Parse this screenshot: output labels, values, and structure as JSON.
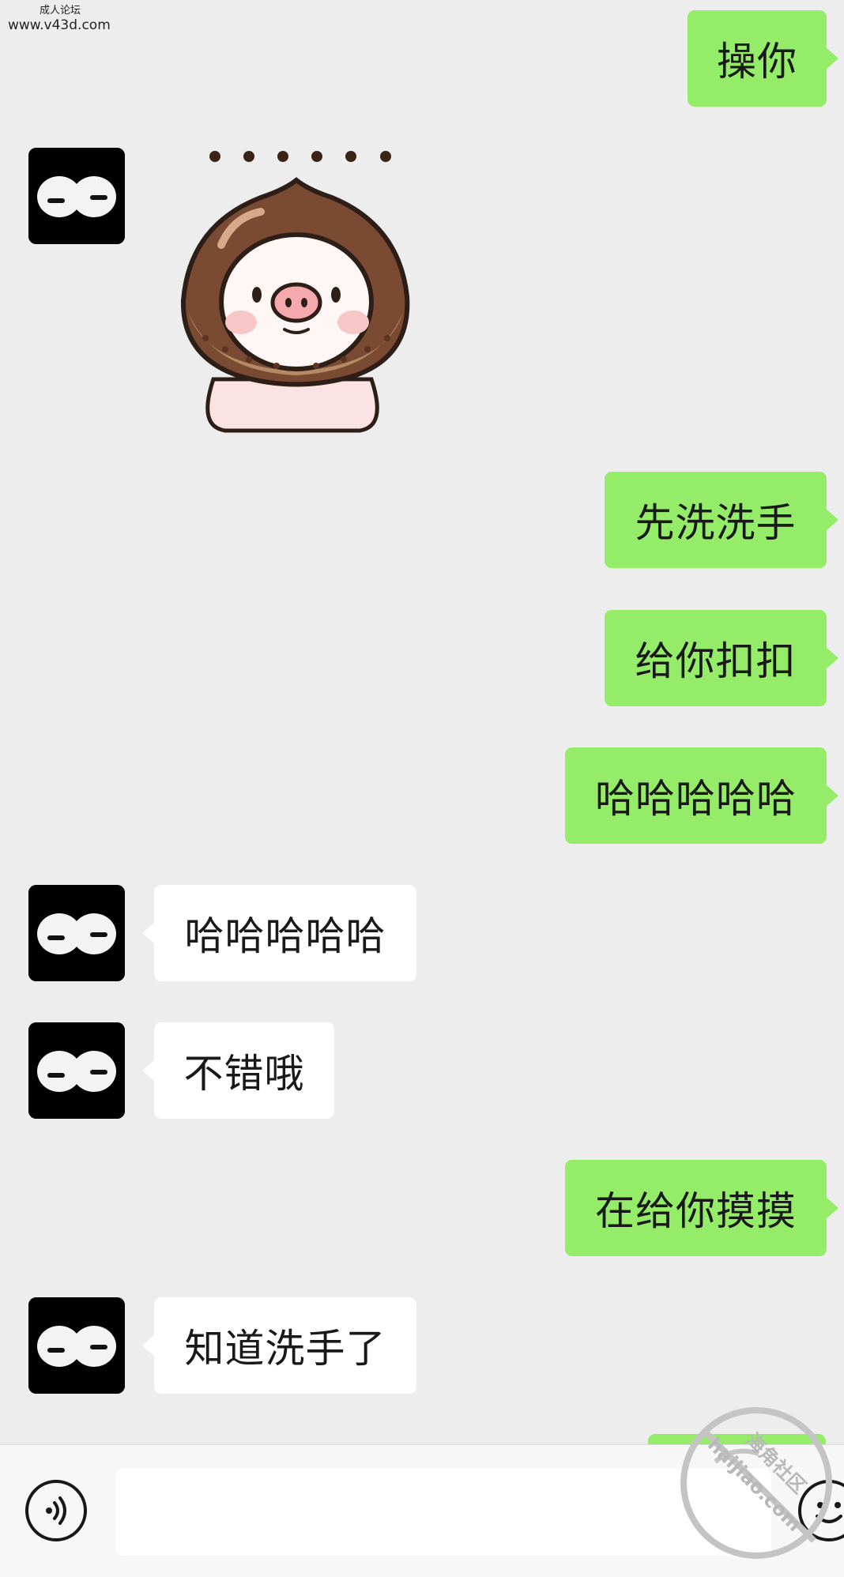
{
  "watermark": {
    "line1": "成人论坛",
    "line2": "www.v43d.com"
  },
  "messages": [
    {
      "id": "msg-1",
      "from": "me",
      "type": "text",
      "text": "操你"
    },
    {
      "id": "msg-2",
      "from": "contact",
      "type": "sticker",
      "sticker": "chestnut-pig-sticker with six dots"
    },
    {
      "id": "msg-3",
      "from": "me",
      "type": "text",
      "text": "先洗洗手"
    },
    {
      "id": "msg-4",
      "from": "me",
      "type": "text",
      "text": "给你扣扣"
    },
    {
      "id": "msg-5",
      "from": "me",
      "type": "text",
      "text": "哈哈哈哈哈"
    },
    {
      "id": "msg-6",
      "from": "contact",
      "type": "text",
      "text": "哈哈哈哈哈"
    },
    {
      "id": "msg-7",
      "from": "contact",
      "type": "text",
      "text": "不错哦"
    },
    {
      "id": "msg-8",
      "from": "me",
      "type": "text",
      "text": "在给你摸摸"
    },
    {
      "id": "msg-9",
      "from": "contact",
      "type": "text",
      "text": "知道洗手了"
    }
  ],
  "input_bar": {
    "voice_icon": "voice-icon",
    "emoji_icon": "emoji-icon",
    "input_value": ""
  },
  "stamp": {
    "text_cn": "海角社区",
    "text_en": "haijiao.com"
  },
  "colors": {
    "background": "#ededed",
    "sent_bubble": "#95ec69",
    "received_bubble": "#ffffff",
    "avatar_bg": "#000000"
  }
}
